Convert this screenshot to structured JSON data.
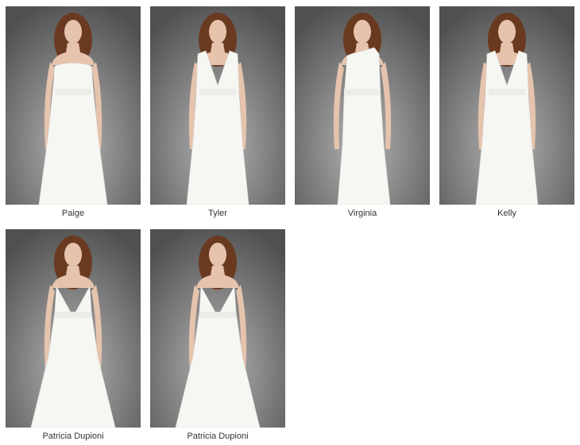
{
  "gallery": {
    "items": [
      {
        "name": "Paige",
        "style": "strapless"
      },
      {
        "name": "Tyler",
        "style": "wrap-flutter"
      },
      {
        "name": "Virginia",
        "style": "one-shoulder"
      },
      {
        "name": "Kelly",
        "style": "wrap-flutter"
      },
      {
        "name": "Patricia Dupioni",
        "style": "vneck-ballgown"
      },
      {
        "name": "Patricia Dupioni",
        "style": "vneck-ballgown"
      }
    ]
  },
  "colors": {
    "backdrop_light": "#b4b4b4",
    "backdrop_dark": "#505050",
    "dress": "#f6f6f3",
    "skin": "#e6c3ad",
    "hair": "#6a3a20",
    "caption_text": "#333333"
  }
}
